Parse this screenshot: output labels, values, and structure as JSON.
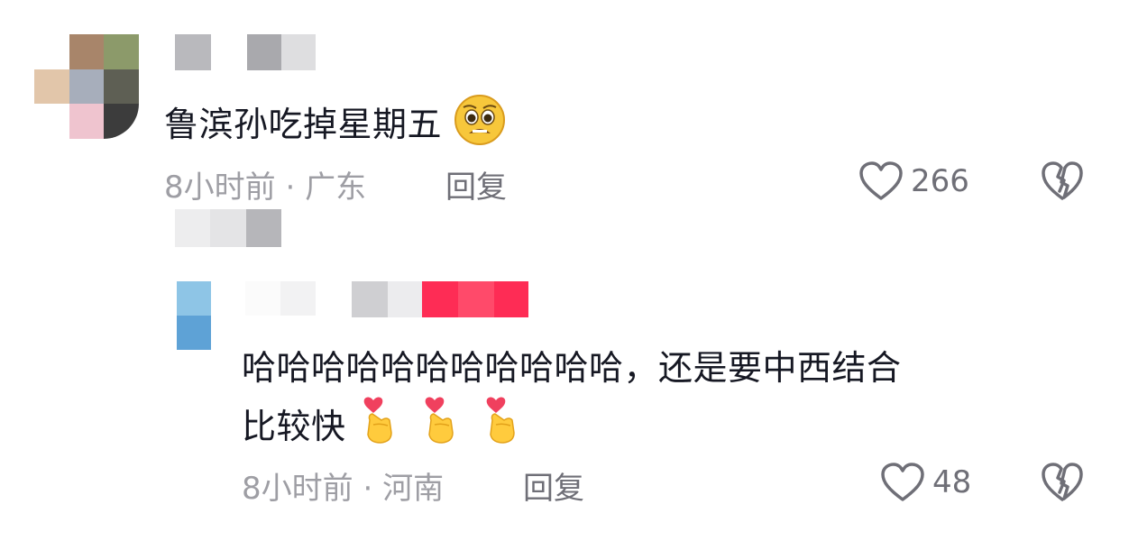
{
  "comments": [
    {
      "text": "鲁滨孙吃掉星期五",
      "emoji": "pleading-face-emoji",
      "time": "8小时前",
      "location": "广东",
      "separator": "·",
      "reply_label": "回复",
      "like_count": "266",
      "avatar": "blurred-avatar",
      "username": "blurred-username"
    },
    {
      "text_line1": "哈哈哈哈哈哈哈哈哈哈哈，还是要中西结合",
      "text_line2": "比较快",
      "emoji": "finger-heart-emoji",
      "emoji_count": 3,
      "time": "8小时前",
      "location": "河南",
      "separator": "·",
      "reply_label": "回复",
      "like_count": "48",
      "avatar": "blurred-avatar",
      "username": "blurred-username",
      "badge": "blurred-badge"
    }
  ],
  "icons": {
    "like": "heart-outline-icon",
    "dislike": "broken-heart-icon"
  },
  "colors": {
    "text": "#161823",
    "meta": "#9e9ea4",
    "badge": "#fe2c55"
  }
}
